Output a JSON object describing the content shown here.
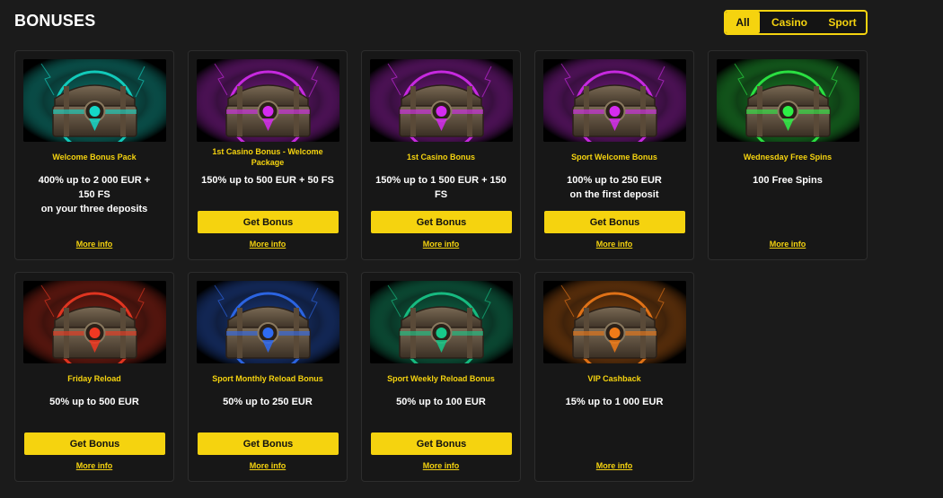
{
  "header": {
    "title": "BONUSES"
  },
  "filters": [
    {
      "label": "All",
      "active": true
    },
    {
      "label": "Casino",
      "active": false
    },
    {
      "label": "Sport",
      "active": false
    }
  ],
  "cards": [
    {
      "title": "Welcome Bonus Pack",
      "lines": [
        "400% up to 2 000 EUR + 150 FS",
        "on your three deposits"
      ],
      "button": "",
      "more": "More info",
      "chest_color": "#14d8c8",
      "glow": "teal"
    },
    {
      "title": "1st Casino Bonus - Welcome Package",
      "lines": [
        "150% up to 500 EUR + 50 FS"
      ],
      "button": "Get Bonus",
      "more": "More info",
      "chest_color": "#d52cf0",
      "glow": "purple"
    },
    {
      "title": "1st Casino Bonus",
      "lines": [
        "150% up to 1 500 EUR + 150 FS"
      ],
      "button": "Get Bonus",
      "more": "More info",
      "chest_color": "#d52cf0",
      "glow": "purple"
    },
    {
      "title": "Sport Welcome Bonus",
      "lines": [
        "100% up to 250 EUR",
        "on the first deposit"
      ],
      "button": "Get Bonus",
      "more": "More info",
      "chest_color": "#d52cf0",
      "glow": "purple"
    },
    {
      "title": "Wednesday Free Spins",
      "lines": [
        "100 Free Spins"
      ],
      "button": "",
      "more": "More info",
      "chest_color": "#2df046",
      "glow": "green"
    },
    {
      "title": "Friday Reload",
      "lines": [
        "50% up to 500 EUR"
      ],
      "button": "Get Bonus",
      "more": "More info",
      "chest_color": "#f03822",
      "glow": "red"
    },
    {
      "title": "Sport Monthly Reload Bonus",
      "lines": [
        "50% up to 250 EUR"
      ],
      "button": "Get Bonus",
      "more": "More info",
      "chest_color": "#2f6bf2",
      "glow": "blue"
    },
    {
      "title": "Sport Weekly Reload Bonus",
      "lines": [
        "50% up to 100 EUR"
      ],
      "button": "Get Bonus",
      "more": "More info",
      "chest_color": "#18c88a",
      "glow": "emerald"
    },
    {
      "title": "VIP Cashback",
      "lines": [
        "15% up to 1 000 EUR"
      ],
      "button": "",
      "more": "More info",
      "chest_color": "#f07a18",
      "glow": "orange"
    }
  ],
  "colors": {
    "accent": "#f5d30f",
    "background": "#1b1b1b",
    "card": "#171717"
  }
}
